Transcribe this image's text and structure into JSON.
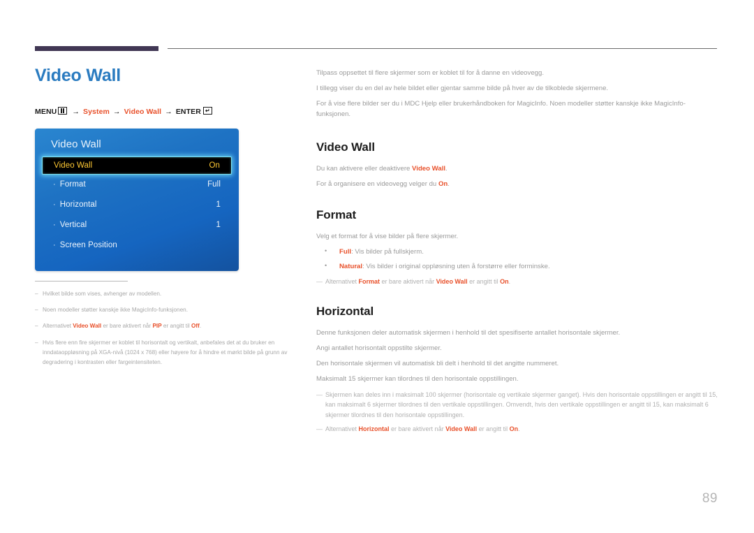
{
  "page": {
    "number": "89",
    "title": "Video Wall",
    "accent_blue": "#2a7bc0",
    "accent_red": "#e8502a",
    "rule_color": "#413754"
  },
  "breadcrumb": {
    "menu_label": "MENU",
    "menu_icon": "menu-grid-icon",
    "arrow": "→",
    "item1": "System",
    "item2": "Video Wall",
    "enter_label": "ENTER",
    "enter_icon": "enter-key-icon"
  },
  "osd": {
    "title": "Video Wall",
    "rows": [
      {
        "label": "Video Wall",
        "value": "On",
        "selected": true,
        "dot": ""
      },
      {
        "label": "Format",
        "value": "Full",
        "selected": false,
        "dot": "·"
      },
      {
        "label": "Horizontal",
        "value": "1",
        "selected": false,
        "dot": "·"
      },
      {
        "label": "Vertical",
        "value": "1",
        "selected": false,
        "dot": "·"
      },
      {
        "label": "Screen Position",
        "value": "",
        "selected": false,
        "dot": "·"
      }
    ]
  },
  "left_notes": [
    {
      "dash": "–",
      "html": "Hvilket bilde som vises, avhenger av modellen."
    },
    {
      "dash": "–",
      "html": "Noen modeller støtter kanskje ikke MagicInfo-funksjonen."
    },
    {
      "dash": "–",
      "html": "Alternativet <b>Video Wall</b> er bare aktivert når <b>PIP</b> er angitt til <b>Off</b>."
    },
    {
      "dash": "–",
      "html": "Hvis flere enn fire skjermer er koblet til horisontalt og vertikalt, anbefales det at du bruker en inndataoppløsning på XGA-nivå (1024 x 768) eller høyere for å hindre et mørkt bilde på grunn av degradering i kontrasten eller fargeintensiteten."
    }
  ],
  "right": {
    "intro": [
      "Tilpass oppsettet til flere skjermer som er koblet til for å danne en videovegg.",
      "I tillegg viser du en del av hele bildet eller gjentar samme bilde på hver av de tilkoblede skjermene.",
      "For å vise flere bilder ser du i MDC Hjelp eller brukerhåndboken for MagicInfo. Noen modeller støtter kanskje ikke MagicInfo-funksjonen."
    ],
    "sections": [
      {
        "heading": "Video Wall",
        "paras": [
          "Du kan aktivere eller deaktivere <span class=\"hl\">Video Wall</span>.",
          "For å organisere en videovegg velger du <span class=\"hl\">On</span>."
        ],
        "bullets": [],
        "notes": []
      },
      {
        "heading": "Format",
        "paras": [
          "Velg et format for å vise bilder på flere skjermer."
        ],
        "bullets": [
          "<span class=\"hl\">Full</span>: Vis bilder på fullskjerm.",
          "<span class=\"hl\">Natural</span>: Vis bilder i original oppløsning uten å forstørre eller forminske."
        ],
        "notes": [
          "Alternativet <span class=\"hl\">Format</span> er bare aktivert når <span class=\"hl\">Video Wall</span> er angitt til <span class=\"hl\">On</span>."
        ]
      },
      {
        "heading": "Horizontal",
        "paras": [
          "Denne funksjonen deler automatisk skjermen i henhold til det spesifiserte antallet horisontale skjermer.",
          "Angi antallet horisontalt oppstilte skjermer.",
          "Den horisontale skjermen vil automatisk bli delt i henhold til det angitte nummeret.",
          "Maksimalt 15 skjermer kan tilordnes til den horisontale oppstillingen."
        ],
        "bullets": [],
        "notes": [
          "Skjermen kan deles inn i maksimalt 100 skjermer (horisontale og vertikale skjermer ganget). Hvis den horisontale oppstillingen er angitt til 15, kan maksimalt 6 skjermer tilordnes til den vertikale oppstillingen. Omvendt, hvis den vertikale oppstillingen er angitt til 15, kan maksimalt 6 skjermer tilordnes til den horisontale oppstillingen.",
          "Alternativet <span class=\"hl\">Horizontal</span> er bare aktivert når <span class=\"hl\">Video Wall</span> er angitt til <span class=\"hl\">On</span>."
        ]
      }
    ]
  }
}
